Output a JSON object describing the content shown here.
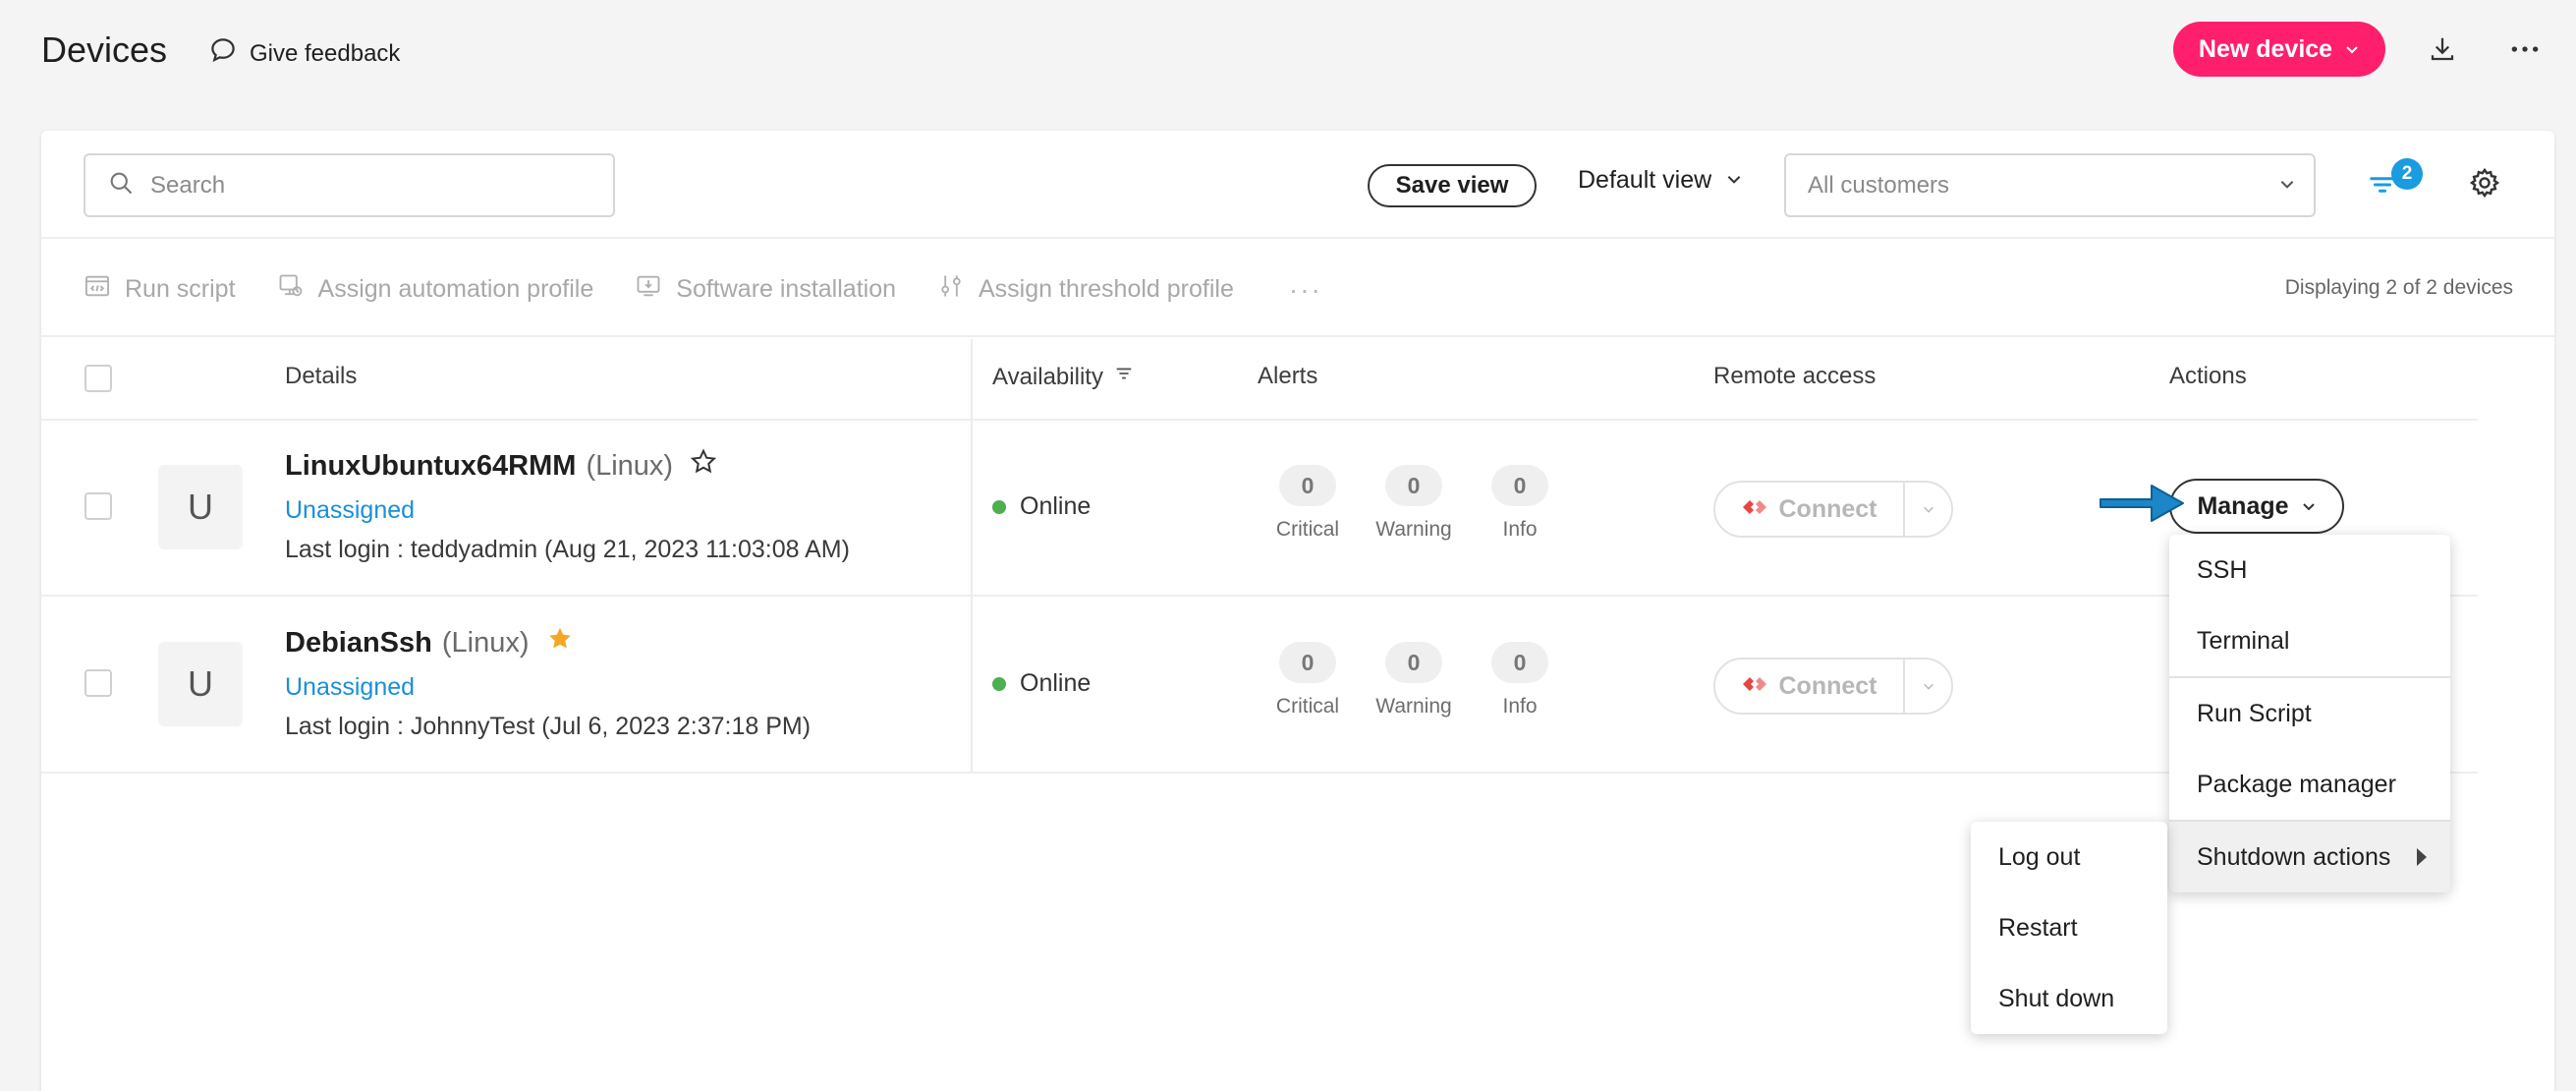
{
  "header": {
    "title": "Devices",
    "feedback_label": "Give feedback",
    "new_device_label": "New device"
  },
  "filters": {
    "search_placeholder": "Search",
    "save_view_label": "Save view",
    "default_view_label": "Default view",
    "customers_placeholder": "All customers",
    "filter_count": "2"
  },
  "toolbar": {
    "run_script": "Run script",
    "assign_automation": "Assign automation profile",
    "software_installation": "Software installation",
    "assign_threshold": "Assign threshold profile",
    "more": "···",
    "displaying": "Displaying 2 of 2 devices"
  },
  "columns": {
    "details": "Details",
    "availability": "Availability",
    "alerts": "Alerts",
    "remote_access": "Remote access",
    "actions": "Actions"
  },
  "devices": [
    {
      "avatar": "U",
      "name": "LinuxUbuntux64RMM",
      "os": "(Linux)",
      "favorite": false,
      "assignment": "Unassigned",
      "last_login": "Last login : teddyadmin (Aug 21, 2023 11:03:08 AM)",
      "status": "Online",
      "alerts": [
        {
          "count": "0",
          "label": "Critical"
        },
        {
          "count": "0",
          "label": "Warning"
        },
        {
          "count": "0",
          "label": "Info"
        }
      ],
      "connect_label": "Connect"
    },
    {
      "avatar": "U",
      "name": "DebianSsh",
      "os": "(Linux)",
      "favorite": true,
      "assignment": "Unassigned",
      "last_login": "Last login : JohnnyTest (Jul 6, 2023 2:37:18 PM)",
      "status": "Online",
      "alerts": [
        {
          "count": "0",
          "label": "Critical"
        },
        {
          "count": "0",
          "label": "Warning"
        },
        {
          "count": "0",
          "label": "Info"
        }
      ],
      "connect_label": "Connect"
    }
  ],
  "manage": {
    "label": "Manage",
    "menu": [
      "SSH",
      "Terminal",
      "Run Script",
      "Package manager",
      "Shutdown actions"
    ],
    "submenu": [
      "Log out",
      "Restart",
      "Shut down"
    ]
  },
  "colors": {
    "brand": "#ff1f6d",
    "link": "#1a8fd8",
    "online": "#4caf50",
    "badge": "#1b9be0",
    "star": "#f5a623"
  }
}
